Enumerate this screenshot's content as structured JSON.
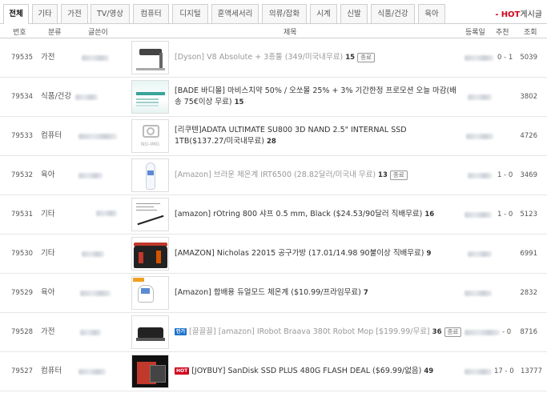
{
  "tabs": [
    {
      "label": "전체",
      "active": true
    },
    {
      "label": "기타",
      "active": false
    },
    {
      "label": "가전",
      "active": false
    },
    {
      "label": "TV/영상",
      "active": false
    },
    {
      "label": "컴퓨터",
      "active": false
    },
    {
      "label": "디지털",
      "active": false
    },
    {
      "label": "훈액세서리",
      "active": false
    },
    {
      "label": "의류/잡화",
      "active": false
    },
    {
      "label": "시계",
      "active": false
    },
    {
      "label": "신발",
      "active": false
    },
    {
      "label": "식품/건강",
      "active": false
    },
    {
      "label": "육아",
      "active": false
    }
  ],
  "hot_link": {
    "dash": "-",
    "hot": "HOT",
    "label": "게시글"
  },
  "columns": {
    "number": "번호",
    "category": "분류",
    "author": "글쓴이",
    "title": "제목",
    "date": "등록일",
    "recommend": "추천",
    "views": "조회"
  },
  "posts": [
    {
      "number": "79535",
      "category": "가전",
      "title": "[Dyson] V8 Absolute + 3종툴 (349/미국내무료)",
      "comments": "15",
      "status": "종료",
      "recommend": "0 - 1",
      "views": "5039",
      "greyed": true,
      "badge": null,
      "thumb": "vacuum-thumbnail"
    },
    {
      "number": "79534",
      "category": "식품/건강",
      "title": "[BADE 바디몰] 마비스치약 50% / 오쏘몰 25% + 3% 기간한정 프로모션 오늘 마감(배송 75€이상 무료)",
      "comments": "15",
      "status": null,
      "recommend": "",
      "views": "3802",
      "greyed": false,
      "badge": null,
      "thumb": "promo-banner-thumbnail"
    },
    {
      "number": "79533",
      "category": "컴퓨터",
      "title": "[리쿠텐]ADATA ULTIMATE SU800 3D NAND 2.5\" INTERNAL SSD 1TB($137.27/미국내무료)",
      "comments": "28",
      "status": null,
      "recommend": "",
      "views": "4726",
      "greyed": false,
      "badge": null,
      "thumb": "no-image-thumbnail"
    },
    {
      "number": "79532",
      "category": "육아",
      "title": "[Amazon] 브라운 체온계 IRT6500 (28.82달러/미국내 무료)",
      "comments": "13",
      "status": "종료",
      "recommend": "1 - 0",
      "views": "3469",
      "greyed": true,
      "badge": null,
      "thumb": "thermometer-thumbnail"
    },
    {
      "number": "79531",
      "category": "기타",
      "title": "[amazon] rOtring 800 샤프 0.5 mm, Black ($24.53/90달러 직배무료)",
      "comments": "16",
      "status": null,
      "recommend": "1 - 0",
      "views": "5123",
      "greyed": false,
      "badge": null,
      "thumb": "pencil-thumbnail"
    },
    {
      "number": "79530",
      "category": "기타",
      "title": "[AMAZON] Nicholas 22015 공구가방 (17.01/14.98 90불이상 직배무료)",
      "comments": "9",
      "status": null,
      "recommend": "",
      "views": "6991",
      "greyed": false,
      "badge": null,
      "thumb": "toolbag-thumbnail"
    },
    {
      "number": "79529",
      "category": "육아",
      "title": "[Amazon] 합배용 듀얼모드 체온계 ($10.99/프라임무료)",
      "comments": "7",
      "status": null,
      "recommend": "",
      "views": "2832",
      "greyed": false,
      "badge": null,
      "thumb": "thermometer-gun-thumbnail"
    },
    {
      "number": "79528",
      "category": "가전",
      "title": "[끌끌끌] [amazon] IRobot Braava 380t Robot Mop [$199.99/무료]",
      "comments": "36",
      "status": "종료",
      "recommend": "- 0",
      "views": "8716",
      "greyed": true,
      "badge": {
        "text": "인기",
        "color": "#1e73c9"
      },
      "thumb": "robot-mop-thumbnail"
    },
    {
      "number": "79527",
      "category": "컴퓨터",
      "title": "[JOYBUY] SanDisk SSD PLUS 480G FLASH DEAL ($69.99/없음)",
      "comments": "49",
      "status": null,
      "recommend": "17 - 0",
      "views": "13777",
      "greyed": false,
      "badge": {
        "text": "HOT",
        "color": "#d0021b"
      },
      "thumb": "ssd-thumbnail"
    }
  ]
}
